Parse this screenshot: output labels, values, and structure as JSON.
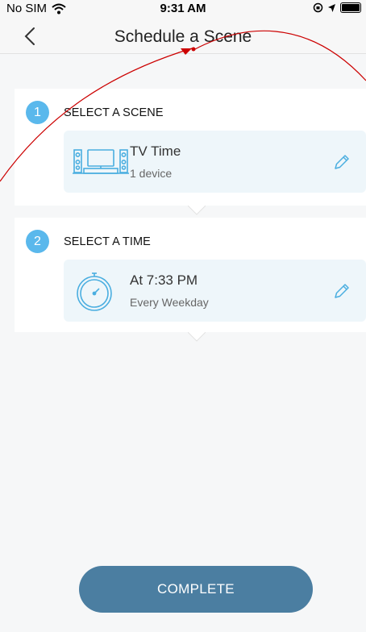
{
  "status_bar": {
    "carrier": "No SIM",
    "time": "9:31 AM"
  },
  "nav": {
    "title": "Schedule a Scene"
  },
  "step1": {
    "number": "1",
    "label": "SELECT A SCENE",
    "card": {
      "title": "TV Time",
      "subtitle": "1 device",
      "icon": "tv-set-icon"
    }
  },
  "step2": {
    "number": "2",
    "label": "SELECT A TIME",
    "card": {
      "title": "At 7:33 PM",
      "subtitle": "Every Weekday",
      "icon": "timer-icon"
    }
  },
  "actions": {
    "complete_label": "COMPLETE"
  },
  "colors": {
    "accent": "#5ab8ec",
    "button": "#4b7ea1",
    "card_bg": "#eef6fa",
    "annotation": "#cc0000"
  }
}
